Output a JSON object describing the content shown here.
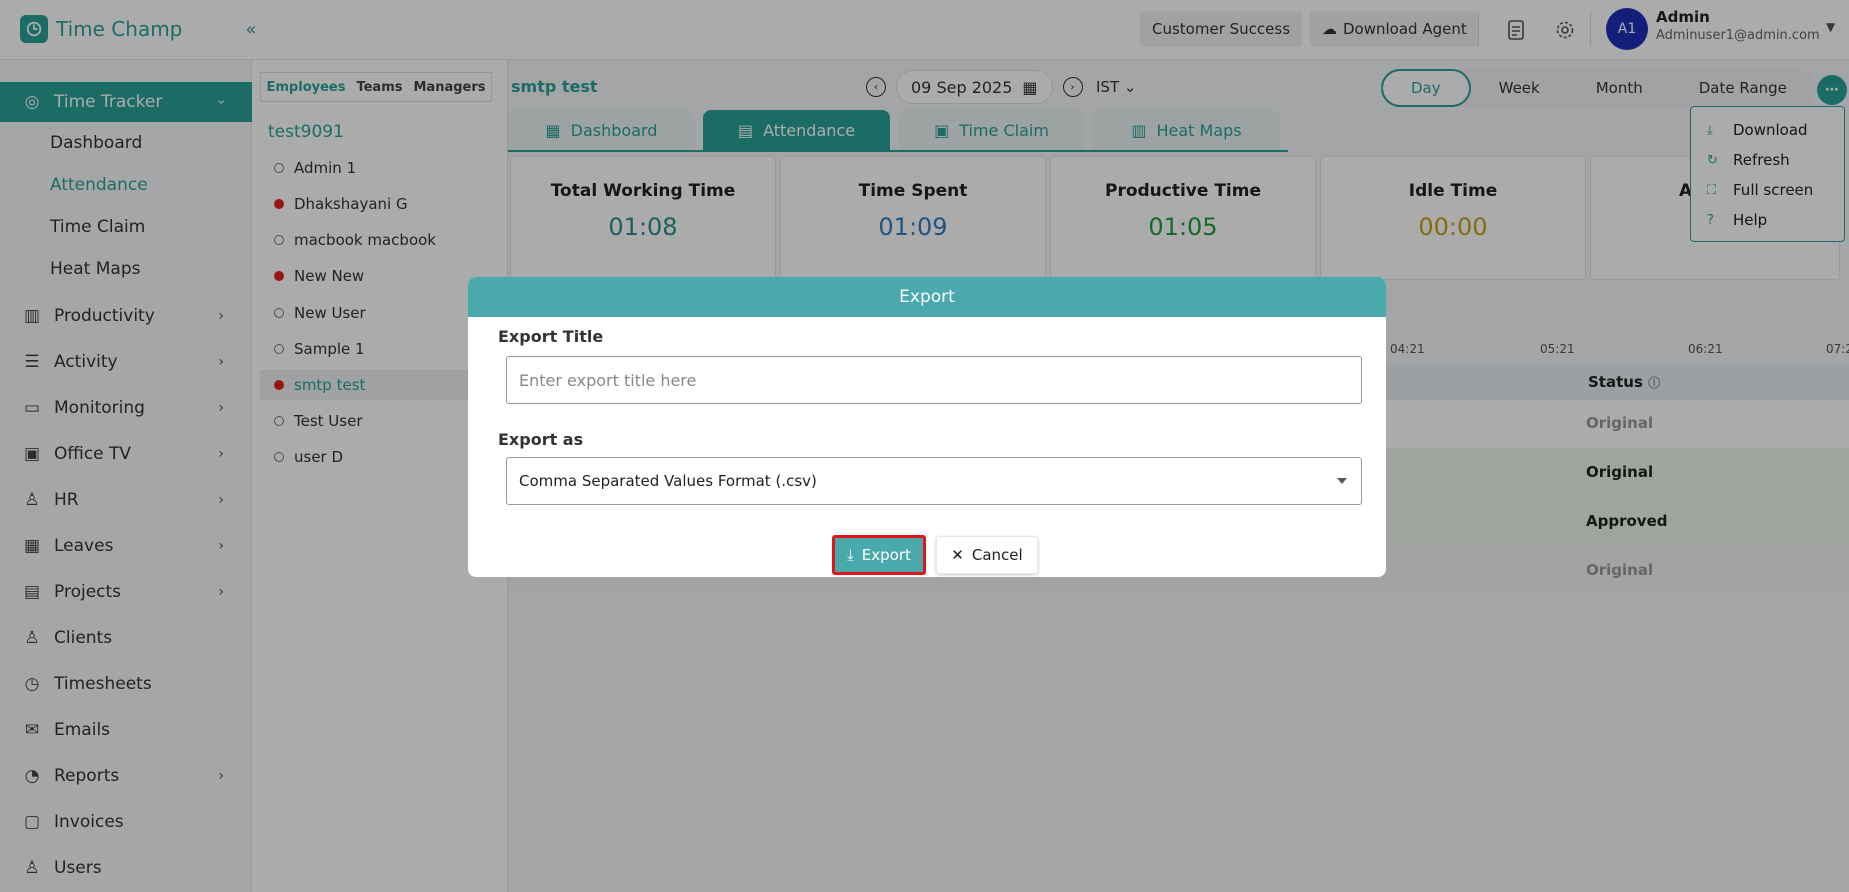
{
  "app": {
    "name": "Time Champ",
    "brand_color": "#2aa198"
  },
  "topbar": {
    "customer_success": "Customer Success",
    "download_agent": "Download Agent",
    "avatar_initials": "A1",
    "user_name": "Admin",
    "user_email": "Adminuser1@admin.com"
  },
  "sidebar": {
    "time_tracker": "Time Tracker",
    "sub_items": [
      "Dashboard",
      "Attendance",
      "Time Claim",
      "Heat Maps"
    ],
    "items": [
      "Productivity",
      "Activity",
      "Monitoring",
      "Office TV",
      "HR",
      "Leaves",
      "Projects",
      "Clients",
      "Timesheets",
      "Emails",
      "Reports",
      "Invoices",
      "Users"
    ]
  },
  "employees": {
    "tabs": [
      "Employees",
      "Teams",
      "Managers"
    ],
    "group": "test9091",
    "list": [
      "Admin 1",
      "Dhakshayani G",
      "macbook macbook",
      "New New",
      "New User",
      "Sample 1",
      "smtp test",
      "Test User",
      "user D"
    ]
  },
  "main": {
    "title": "smtp test",
    "date": "09 Sep 2025",
    "timezone": "IST",
    "range_tabs": [
      "Day",
      "Week",
      "Month",
      "Date Range"
    ],
    "tabs": [
      "Dashboard",
      "Attendance",
      "Time Claim",
      "Heat Maps"
    ],
    "cards": [
      {
        "title": "Total Working Time",
        "value": "01:08",
        "color": "#2a8f8a"
      },
      {
        "title": "Time Spent",
        "value": "01:09",
        "color": "#2f7fc0"
      },
      {
        "title": "Productive Time",
        "value": "01:05",
        "color": "#1f9e3a"
      },
      {
        "title": "Idle Time",
        "value": "00:00",
        "color": "#c9a21a"
      },
      {
        "title": "A",
        "value": "",
        "color": "#333333"
      }
    ],
    "timeline_labels": [
      "04:21",
      "05:21",
      "06:21",
      "07:2"
    ],
    "status_header": "Status",
    "rows": [
      {
        "status": "Original",
        "bg": "#ffffff",
        "color": "#999999"
      },
      {
        "status": "Original",
        "bg": "#eaf6ea",
        "color": "#222222"
      },
      {
        "status": "Approved",
        "bg": "#eaf6ea",
        "color": "#222222"
      },
      {
        "status": "Original",
        "bg": "#f3f3f3",
        "color": "#999999"
      }
    ]
  },
  "more_menu": [
    "Download",
    "Refresh",
    "Full screen",
    "Help"
  ],
  "modal": {
    "title": "Export",
    "export_title_label": "Export Title",
    "export_title_placeholder": "Enter export title here",
    "export_as_label": "Export as",
    "export_as_value": "Comma Separated Values Format (.csv)",
    "export_button": "Export",
    "cancel_button": "Cancel"
  }
}
